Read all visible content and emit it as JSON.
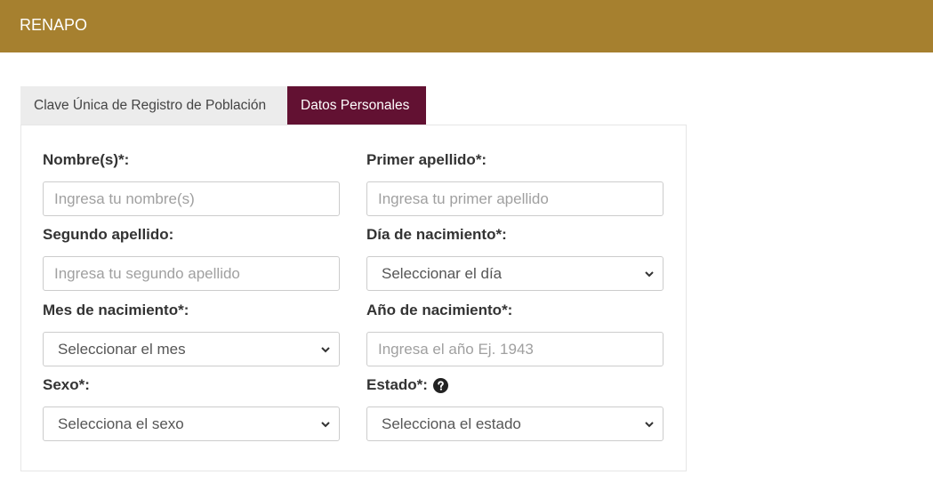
{
  "header": {
    "brand": "RENAPO"
  },
  "tabs": [
    {
      "label": "Clave Única de Registro de Población",
      "active": false
    },
    {
      "label": "Datos Personales",
      "active": true
    }
  ],
  "form": {
    "nombre": {
      "label": "Nombre(s)*:",
      "placeholder": "Ingresa tu nombre(s)"
    },
    "primer_apellido": {
      "label": "Primer apellido*:",
      "placeholder": "Ingresa tu primer apellido"
    },
    "segundo_apellido": {
      "label": "Segundo apellido:",
      "placeholder": "Ingresa tu segundo apellido"
    },
    "dia": {
      "label": "Día de nacimiento*:",
      "selected": "Seleccionar el día"
    },
    "mes": {
      "label": "Mes de nacimiento*:",
      "selected": "Seleccionar el mes"
    },
    "anio": {
      "label": "Año de nacimiento*:",
      "placeholder": "Ingresa el año Ej. 1943"
    },
    "sexo": {
      "label": "Sexo*:",
      "selected": "Selecciona el sexo"
    },
    "estado": {
      "label": "Estado*:",
      "selected": "Selecciona el estado",
      "help_icon": "question-circle-icon"
    }
  },
  "colors": {
    "header_bg": "#a6802f",
    "active_tab_bg": "#621132",
    "inactive_tab_bg": "#ececec"
  }
}
